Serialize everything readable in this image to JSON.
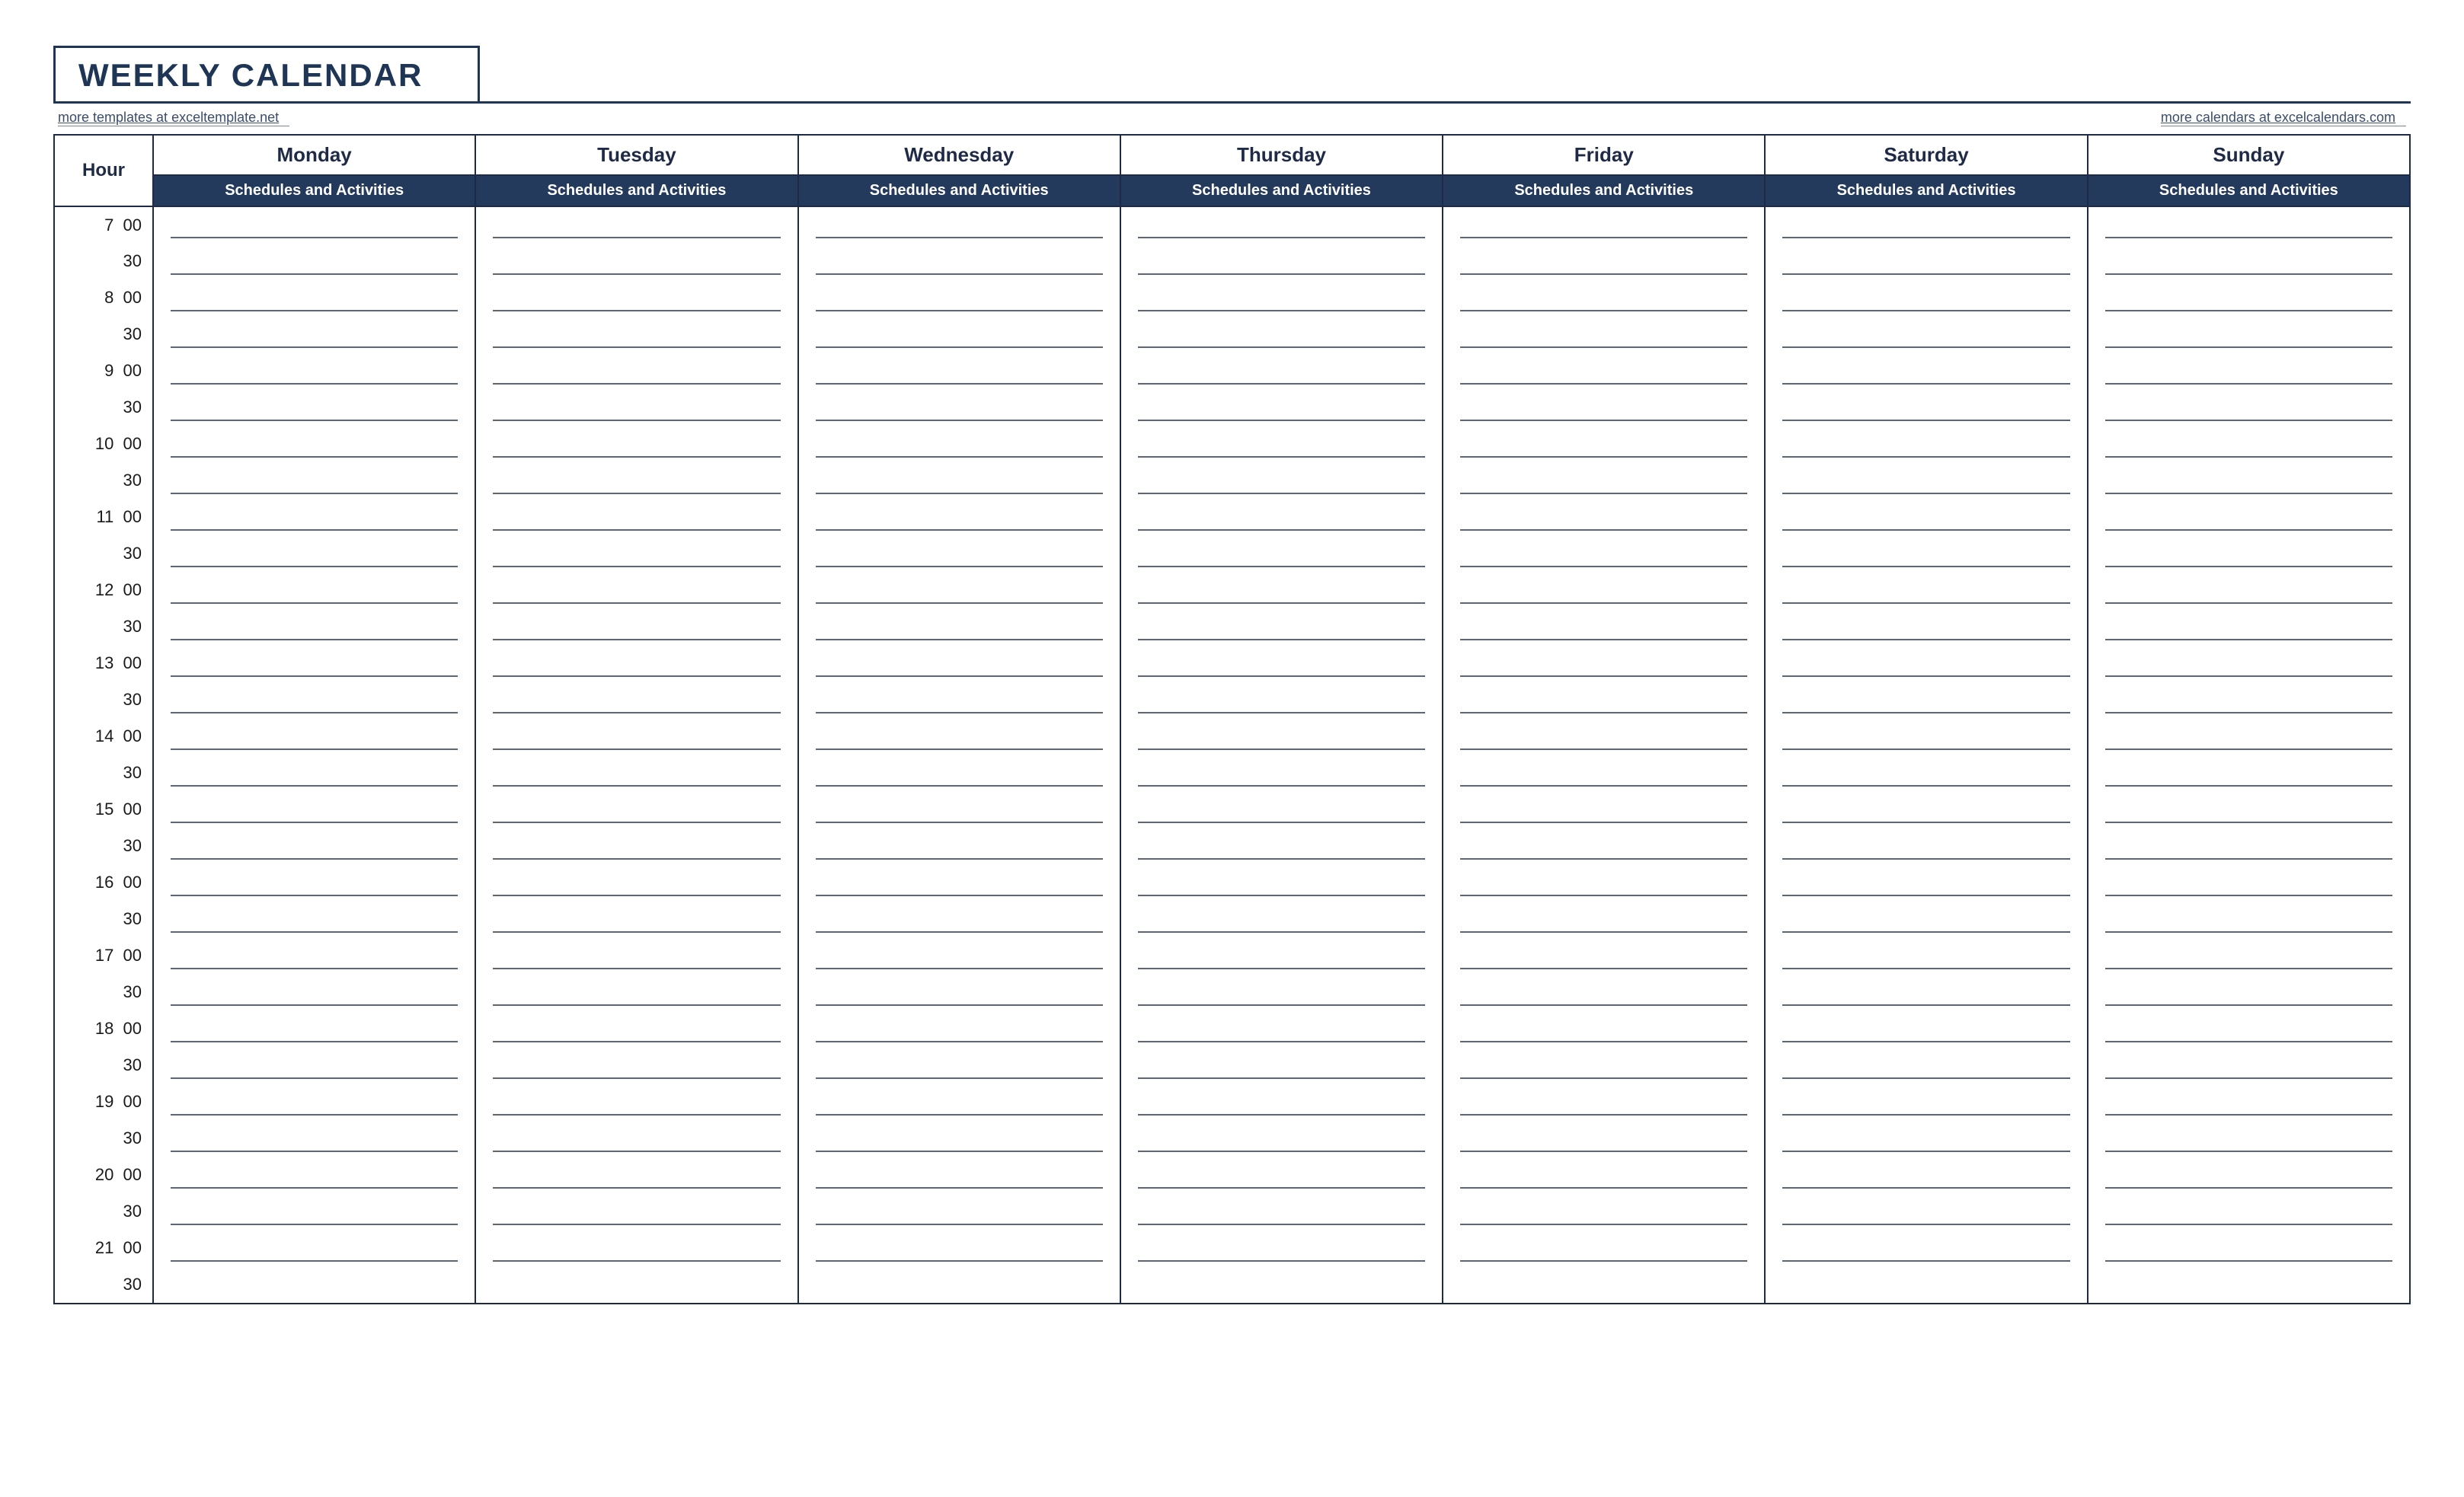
{
  "header": {
    "title": "WEEKLY CALENDAR",
    "left_link_text": "more templates at exceltemplate.net",
    "right_link_text": "more calendars at excelcalendars.com"
  },
  "table": {
    "hour_label": "Hour",
    "subheader": "Schedules and Activities",
    "days": [
      "Monday",
      "Tuesday",
      "Wednesday",
      "Thursday",
      "Friday",
      "Saturday",
      "Sunday"
    ],
    "time_rows": [
      {
        "hour": "7",
        "minute": "00"
      },
      {
        "hour": "",
        "minute": "30"
      },
      {
        "hour": "8",
        "minute": "00"
      },
      {
        "hour": "",
        "minute": "30"
      },
      {
        "hour": "9",
        "minute": "00"
      },
      {
        "hour": "",
        "minute": "30"
      },
      {
        "hour": "10",
        "minute": "00"
      },
      {
        "hour": "",
        "minute": "30"
      },
      {
        "hour": "11",
        "minute": "00"
      },
      {
        "hour": "",
        "minute": "30"
      },
      {
        "hour": "12",
        "minute": "00"
      },
      {
        "hour": "",
        "minute": "30"
      },
      {
        "hour": "13",
        "minute": "00"
      },
      {
        "hour": "",
        "minute": "30"
      },
      {
        "hour": "14",
        "minute": "00"
      },
      {
        "hour": "",
        "minute": "30"
      },
      {
        "hour": "15",
        "minute": "00"
      },
      {
        "hour": "",
        "minute": "30"
      },
      {
        "hour": "16",
        "minute": "00"
      },
      {
        "hour": "",
        "minute": "30"
      },
      {
        "hour": "17",
        "minute": "00"
      },
      {
        "hour": "",
        "minute": "30"
      },
      {
        "hour": "18",
        "minute": "00"
      },
      {
        "hour": "",
        "minute": "30"
      },
      {
        "hour": "19",
        "minute": "00"
      },
      {
        "hour": "",
        "minute": "30"
      },
      {
        "hour": "20",
        "minute": "00"
      },
      {
        "hour": "",
        "minute": "30"
      },
      {
        "hour": "21",
        "minute": "00"
      },
      {
        "hour": "",
        "minute": "30"
      }
    ]
  }
}
